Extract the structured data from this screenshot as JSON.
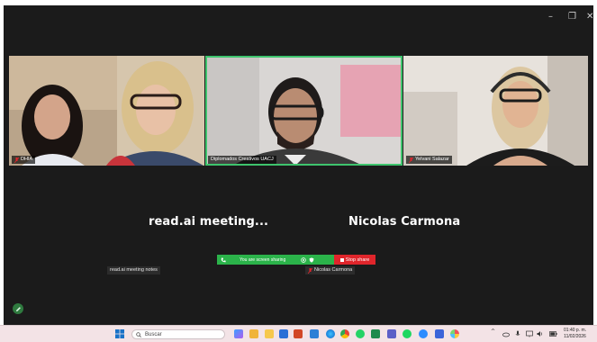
{
  "window": {
    "minimize_glyph": "–",
    "maximize_glyph": "❐",
    "close_glyph": "✕"
  },
  "participants": [
    {
      "name": "DHIA",
      "muted": true
    },
    {
      "name": "Diplomados Creativos UACJ",
      "muted": false,
      "speaking": true
    },
    {
      "name": "Yelvani Salazar",
      "muted": true
    }
  ],
  "stage": {
    "left_name": "read.ai  meeting...",
    "right_name": "Nicolas Carmona",
    "left_plate": "read.ai meeting notes",
    "right_plate": "Nicolas Carmona"
  },
  "share_bar": {
    "status_text": "You are screen sharing",
    "stop_label": "Stop share"
  },
  "taskbar": {
    "search_placeholder": "Buscar",
    "time": "01:40 p. m.",
    "date": "11/02/2026",
    "tray_chevron": "^"
  },
  "colors": {
    "app_bg": "#1b1b1b",
    "active_border": "#3ec46d",
    "share_green": "#2bb34a",
    "stop_red": "#e0252b",
    "taskbar_bg": "#f3e3e6"
  },
  "taskbar_icons": [
    "windows-icon",
    "copilot-icon",
    "files-icon",
    "explorer-icon",
    "powerpoint-icon",
    "outlook-icon",
    "edge-icon",
    "chrome-icon",
    "whatsapp-icon",
    "excel-icon",
    "teams-icon",
    "spotify-icon",
    "zoom-icon",
    "copilot-app-icon",
    "paint-icon"
  ]
}
